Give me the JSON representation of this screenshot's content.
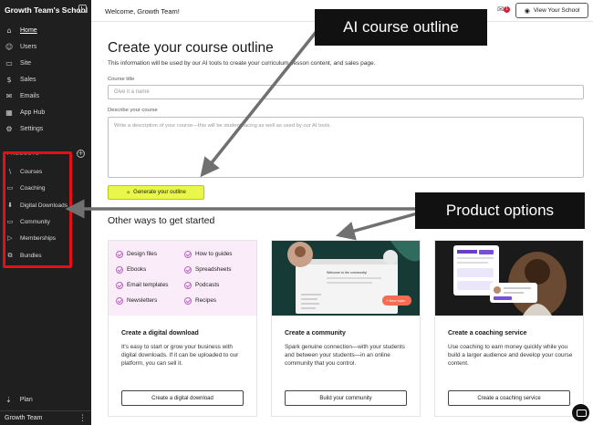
{
  "sidebar": {
    "school_name": "Growth Team's School",
    "nav": [
      {
        "label": "Home",
        "icon": "home-icon",
        "glyph": "⌂",
        "active": true
      },
      {
        "label": "Users",
        "icon": "users-icon",
        "glyph": "☺"
      },
      {
        "label": "Site",
        "icon": "site-icon",
        "glyph": "▭"
      },
      {
        "label": "Sales",
        "icon": "sales-icon",
        "glyph": "$"
      },
      {
        "label": "Emails",
        "icon": "emails-icon",
        "glyph": "✉"
      },
      {
        "label": "App Hub",
        "icon": "app-hub-icon",
        "glyph": "▦"
      },
      {
        "label": "Settings",
        "icon": "settings-icon",
        "glyph": "⚙"
      }
    ],
    "products_header": "PRODUCTS",
    "products": [
      {
        "label": "Courses",
        "icon": "courses-icon",
        "glyph": "\\"
      },
      {
        "label": "Coaching",
        "icon": "coaching-icon",
        "glyph": "▭"
      },
      {
        "label": "Digital Downloads",
        "icon": "digital-downloads-icon",
        "glyph": "⬇"
      },
      {
        "label": "Community",
        "icon": "community-icon",
        "glyph": "▭"
      },
      {
        "label": "Memberships",
        "icon": "memberships-icon",
        "glyph": "▷"
      },
      {
        "label": "Bundles",
        "icon": "bundles-icon",
        "glyph": "⧉"
      }
    ],
    "plan_label": "Plan",
    "user_name": "Growth Team"
  },
  "header": {
    "welcome": "Welcome, Growth Team!",
    "notification_count": "1",
    "view_school_label": "View Your School"
  },
  "main": {
    "title": "Create your course outline",
    "description": "This information will be used by our AI tools to create your curriculum, lesson content, and sales page.",
    "course_title_label": "Course title",
    "course_title_placeholder": "Give it a name",
    "describe_label": "Describe your course",
    "describe_placeholder": "Write a description of your course—this will be student-facing as well as used by our AI tools.",
    "generate_label": "Generate your outline",
    "other_ways_title": "Other ways to get started"
  },
  "cards": [
    {
      "title": "Create a digital download",
      "description": "It's easy to start or grow your business with digital downloads. If it can be uploaded to our platform, you can sell it.",
      "button": "Create a digital download",
      "items": [
        "Design files",
        "How to guides",
        "Ebooks",
        "Spreadsheets",
        "Email templates",
        "Podcasts",
        "Newsletters",
        "Recipes"
      ]
    },
    {
      "title": "Create a community",
      "description": "Spark genuine connection—with your students and between your students—in an online community that you control.",
      "button": "Build your community",
      "image_text": "Welcome to the community!",
      "image_button": "+ New topic"
    },
    {
      "title": "Create a coaching service",
      "description": "Use coaching to earn money quickly while you build a larger audience and develop your course content.",
      "button": "Create a coaching service"
    }
  ],
  "callouts": {
    "ai_outline": "AI course outline",
    "product_options": "Product options"
  },
  "colors": {
    "sidebar_bg": "#1f1f1f",
    "highlight_red": "#e3101a",
    "generate_yellow": "#e8f74a",
    "download_pink": "#fbecfa",
    "community_green": "#163a36"
  }
}
